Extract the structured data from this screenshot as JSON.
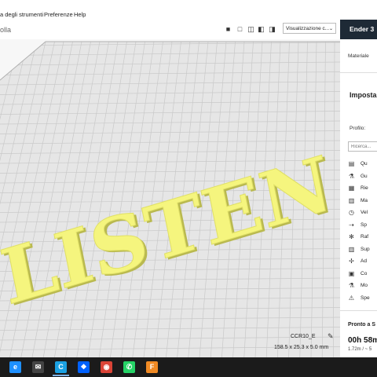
{
  "menubar": {
    "items": [
      "a degli strumenti",
      "Preferenze",
      "Help"
    ]
  },
  "toolbar": {
    "app_title": "olla",
    "view_icons": [
      "view-3d-icon",
      "view-front-icon",
      "view-top-icon",
      "view-left-icon",
      "view-right-icon"
    ],
    "view_select_value": "Visualizzazione c..."
  },
  "printer": {
    "name": "Ender 3"
  },
  "panel": {
    "material_label": "Materiale",
    "settings_title": "Imposta",
    "profile_label": "Profilo:",
    "search_placeholder": "Ricerca...",
    "settings": [
      {
        "icon": "quality-icon",
        "label": "Qu"
      },
      {
        "icon": "shell-icon",
        "label": "Gu"
      },
      {
        "icon": "infill-icon",
        "label": "Rie"
      },
      {
        "icon": "material-icon",
        "label": "Ma"
      },
      {
        "icon": "speed-icon",
        "label": "Vel"
      },
      {
        "icon": "travel-icon",
        "label": "Sp"
      },
      {
        "icon": "cooling-icon",
        "label": "Raf"
      },
      {
        "icon": "support-icon",
        "label": "Sup"
      },
      {
        "icon": "adhesion-icon",
        "label": "Ad"
      },
      {
        "icon": "dual-icon",
        "label": "Co"
      },
      {
        "icon": "mesh-fixes-icon",
        "label": "Mo"
      },
      {
        "icon": "special-modes-icon",
        "label": "Spe"
      }
    ],
    "footer_title": "Pronto a S",
    "print_time": "00h 58m",
    "print_meta": "1.72m / ~ 5"
  },
  "viewport": {
    "model_text": "LISTEN",
    "job_name": "CCR10_E",
    "job_dims": "158.5 x 25.3 x 5.0 mm"
  },
  "taskbar": {
    "apps": [
      {
        "icon": "edge-icon",
        "glyph": "e",
        "color": "#1e90ff"
      },
      {
        "icon": "mail-icon",
        "glyph": "✉",
        "color": "#444"
      },
      {
        "icon": "cura-icon",
        "glyph": "C",
        "color": "#1ba1e2"
      },
      {
        "icon": "dropbox-icon",
        "glyph": "❖",
        "color": "#0061fe"
      },
      {
        "icon": "chrome-icon",
        "glyph": "◉",
        "color": "#db4437"
      },
      {
        "icon": "whatsapp-icon",
        "glyph": "✆",
        "color": "#25d366"
      },
      {
        "icon": "fusion-icon",
        "glyph": "F",
        "color": "#f08a24"
      }
    ]
  }
}
